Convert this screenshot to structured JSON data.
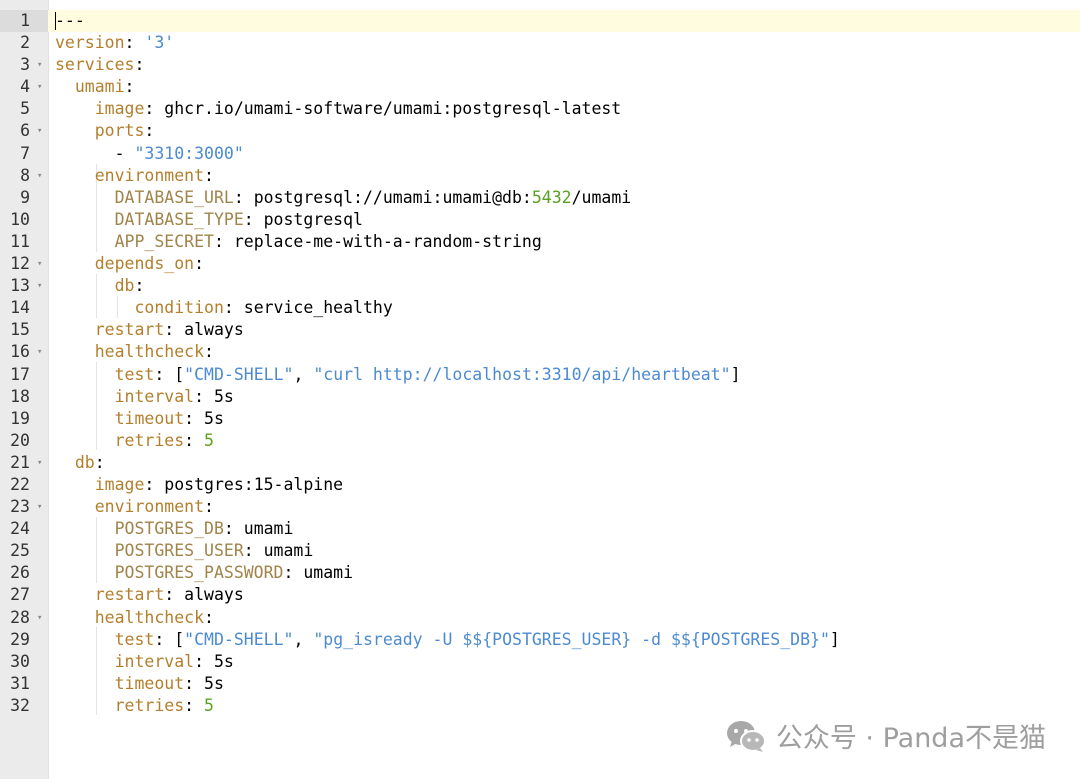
{
  "editor": {
    "language": "yaml",
    "active_line": 1
  },
  "lines": [
    {
      "n": "1",
      "tokens": [
        [
          "p",
          "---"
        ]
      ]
    },
    {
      "n": "2",
      "tokens": [
        [
          "k",
          "version"
        ],
        [
          "p",
          ": "
        ],
        [
          "s",
          "'3'"
        ]
      ]
    },
    {
      "n": "3",
      "fold": true,
      "tokens": [
        [
          "k",
          "services"
        ],
        [
          "p",
          ":"
        ]
      ]
    },
    {
      "n": "4",
      "fold": true,
      "tokens": [
        [
          "p",
          "  "
        ],
        [
          "k",
          "umami"
        ],
        [
          "p",
          ":"
        ]
      ]
    },
    {
      "n": "5",
      "tokens": [
        [
          "p",
          "    "
        ],
        [
          "k",
          "image"
        ],
        [
          "p",
          ": ghcr.io/umami-software/umami:postgresql-latest"
        ]
      ]
    },
    {
      "n": "6",
      "fold": true,
      "tokens": [
        [
          "p",
          "    "
        ],
        [
          "k",
          "ports"
        ],
        [
          "p",
          ":"
        ]
      ]
    },
    {
      "n": "7",
      "tokens": [
        [
          "p",
          "      - "
        ],
        [
          "s",
          "\"3310:3000\""
        ]
      ]
    },
    {
      "n": "8",
      "fold": true,
      "tokens": [
        [
          "p",
          "    "
        ],
        [
          "k",
          "environment"
        ],
        [
          "p",
          ":"
        ]
      ]
    },
    {
      "n": "9",
      "tokens": [
        [
          "p",
          "      "
        ],
        [
          "ak",
          "DATABASE_URL"
        ],
        [
          "p",
          ": postgresql://umami:umami@db:"
        ],
        [
          "n",
          "5432"
        ],
        [
          "p",
          "/umami"
        ]
      ]
    },
    {
      "n": "10",
      "tokens": [
        [
          "p",
          "      "
        ],
        [
          "ak",
          "DATABASE_TYPE"
        ],
        [
          "p",
          ": postgresql"
        ]
      ]
    },
    {
      "n": "11",
      "tokens": [
        [
          "p",
          "      "
        ],
        [
          "ak",
          "APP_SECRET"
        ],
        [
          "p",
          ": replace-me-with-a-random-string"
        ]
      ]
    },
    {
      "n": "12",
      "fold": true,
      "tokens": [
        [
          "p",
          "    "
        ],
        [
          "k",
          "depends_on"
        ],
        [
          "p",
          ":"
        ]
      ]
    },
    {
      "n": "13",
      "fold": true,
      "tokens": [
        [
          "p",
          "      "
        ],
        [
          "k",
          "db"
        ],
        [
          "p",
          ":"
        ]
      ]
    },
    {
      "n": "14",
      "tokens": [
        [
          "p",
          "        "
        ],
        [
          "k",
          "condition"
        ],
        [
          "p",
          ": service_healthy"
        ]
      ]
    },
    {
      "n": "15",
      "tokens": [
        [
          "p",
          "    "
        ],
        [
          "k",
          "restart"
        ],
        [
          "p",
          ": always"
        ]
      ]
    },
    {
      "n": "16",
      "fold": true,
      "tokens": [
        [
          "p",
          "    "
        ],
        [
          "k",
          "healthcheck"
        ],
        [
          "p",
          ":"
        ]
      ]
    },
    {
      "n": "17",
      "tokens": [
        [
          "p",
          "      "
        ],
        [
          "k",
          "test"
        ],
        [
          "p",
          ": ["
        ],
        [
          "s",
          "\"CMD-SHELL\""
        ],
        [
          "p",
          ", "
        ],
        [
          "s",
          "\"curl http://localhost:3310/api/heartbeat\""
        ],
        [
          "p",
          "]"
        ]
      ]
    },
    {
      "n": "18",
      "tokens": [
        [
          "p",
          "      "
        ],
        [
          "k",
          "interval"
        ],
        [
          "p",
          ": 5s"
        ]
      ]
    },
    {
      "n": "19",
      "tokens": [
        [
          "p",
          "      "
        ],
        [
          "k",
          "timeout"
        ],
        [
          "p",
          ": 5s"
        ]
      ]
    },
    {
      "n": "20",
      "tokens": [
        [
          "p",
          "      "
        ],
        [
          "k",
          "retries"
        ],
        [
          "p",
          ": "
        ],
        [
          "n",
          "5"
        ]
      ]
    },
    {
      "n": "21",
      "fold": true,
      "tokens": [
        [
          "p",
          "  "
        ],
        [
          "k",
          "db"
        ],
        [
          "p",
          ":"
        ]
      ]
    },
    {
      "n": "22",
      "tokens": [
        [
          "p",
          "    "
        ],
        [
          "k",
          "image"
        ],
        [
          "p",
          ": postgres:15-alpine"
        ]
      ]
    },
    {
      "n": "23",
      "fold": true,
      "tokens": [
        [
          "p",
          "    "
        ],
        [
          "k",
          "environment"
        ],
        [
          "p",
          ":"
        ]
      ]
    },
    {
      "n": "24",
      "tokens": [
        [
          "p",
          "      "
        ],
        [
          "ak",
          "POSTGRES_DB"
        ],
        [
          "p",
          ": umami"
        ]
      ]
    },
    {
      "n": "25",
      "tokens": [
        [
          "p",
          "      "
        ],
        [
          "ak",
          "POSTGRES_USER"
        ],
        [
          "p",
          ": umami"
        ]
      ]
    },
    {
      "n": "26",
      "tokens": [
        [
          "p",
          "      "
        ],
        [
          "ak",
          "POSTGRES_PASSWORD"
        ],
        [
          "p",
          ": umami"
        ]
      ]
    },
    {
      "n": "27",
      "tokens": [
        [
          "p",
          "    "
        ],
        [
          "k",
          "restart"
        ],
        [
          "p",
          ": always"
        ]
      ]
    },
    {
      "n": "28",
      "fold": true,
      "tokens": [
        [
          "p",
          "    "
        ],
        [
          "k",
          "healthcheck"
        ],
        [
          "p",
          ":"
        ]
      ]
    },
    {
      "n": "29",
      "tokens": [
        [
          "p",
          "      "
        ],
        [
          "k",
          "test"
        ],
        [
          "p",
          ": ["
        ],
        [
          "s",
          "\"CMD-SHELL\""
        ],
        [
          "p",
          ", "
        ],
        [
          "s",
          "\"pg_isready -U $${POSTGRES_USER} -d $${POSTGRES_DB}\""
        ],
        [
          "p",
          "]"
        ]
      ]
    },
    {
      "n": "30",
      "tokens": [
        [
          "p",
          "      "
        ],
        [
          "k",
          "interval"
        ],
        [
          "p",
          ": 5s"
        ]
      ]
    },
    {
      "n": "31",
      "tokens": [
        [
          "p",
          "      "
        ],
        [
          "k",
          "timeout"
        ],
        [
          "p",
          ": 5s"
        ]
      ]
    },
    {
      "n": "32",
      "tokens": [
        [
          "p",
          "      "
        ],
        [
          "k",
          "retries"
        ],
        [
          "p",
          ": "
        ],
        [
          "n",
          "5"
        ]
      ]
    }
  ],
  "fold_glyph": "▾",
  "watermark": {
    "text": "公众号 · Panda不是猫",
    "icon": "wechat-icon"
  },
  "colors": {
    "key": "#b37f2c",
    "string": "#4c8bd1",
    "number": "#5aa121",
    "gutter": "#ebebeb",
    "active_line": "#fffce0"
  }
}
